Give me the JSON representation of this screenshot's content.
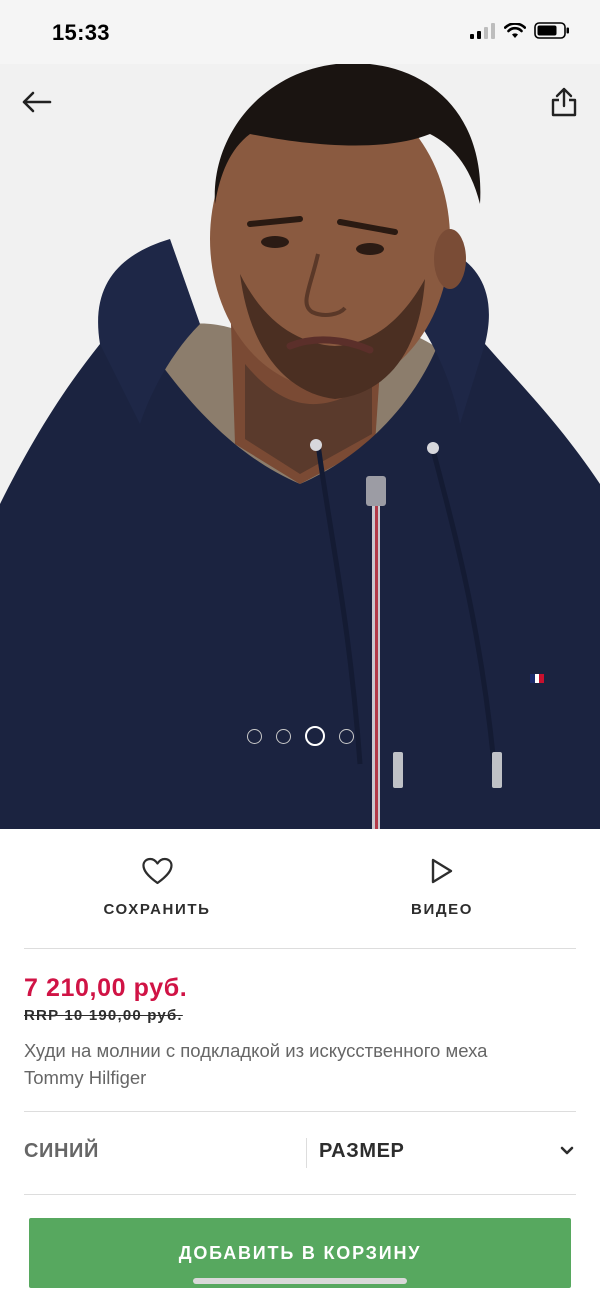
{
  "status_bar": {
    "time": "15:33"
  },
  "icons": {
    "back": "arrow-left-icon",
    "share": "share-icon",
    "save": "heart-icon",
    "video": "play-icon",
    "size_dropdown": "chevron-down-icon"
  },
  "gallery": {
    "image_count": 4,
    "active_index": 2
  },
  "actions": {
    "save_label": "СОХРАНИТЬ",
    "video_label": "ВИДЕО"
  },
  "product": {
    "price": "7 210,00 руб.",
    "rrp": "RRP 10 190,00 руб.",
    "name_line1": "Худи на молнии с подкладкой из искусственного меха",
    "name_line2": "Tommy Hilfiger"
  },
  "selectors": {
    "color": "СИНИЙ",
    "size": "РАЗМЕР"
  },
  "cart": {
    "label": "ДОБАВИТЬ В КОРЗИНУ"
  },
  "colors": {
    "price": "#d01345",
    "cart_button": "#57a85f",
    "hoodie": "#1b2340"
  }
}
